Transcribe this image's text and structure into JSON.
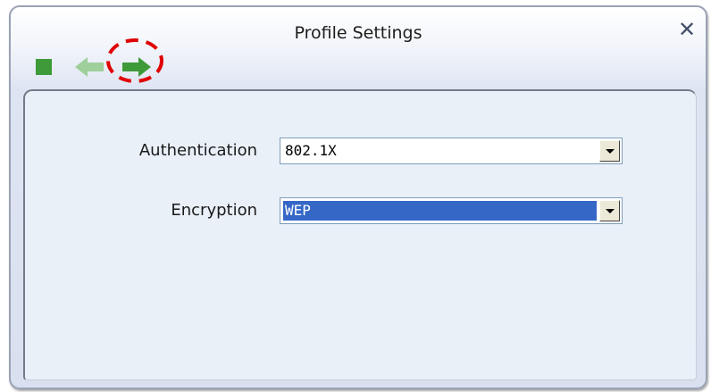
{
  "window": {
    "title": "Profile Settings",
    "close_glyph": "✕"
  },
  "toolbar": {
    "stop_icon": "stop-icon",
    "back_icon": "back-arrow-icon",
    "next_icon": "next-arrow-icon",
    "icon_color": "#3f9a3a",
    "disabled_color": "#9fcf9b"
  },
  "form": {
    "authentication": {
      "label": "Authentication",
      "value": "802.1X"
    },
    "encryption": {
      "label": "Encryption",
      "value": "WEP",
      "selected": true
    }
  },
  "highlight_color": "#e00000"
}
